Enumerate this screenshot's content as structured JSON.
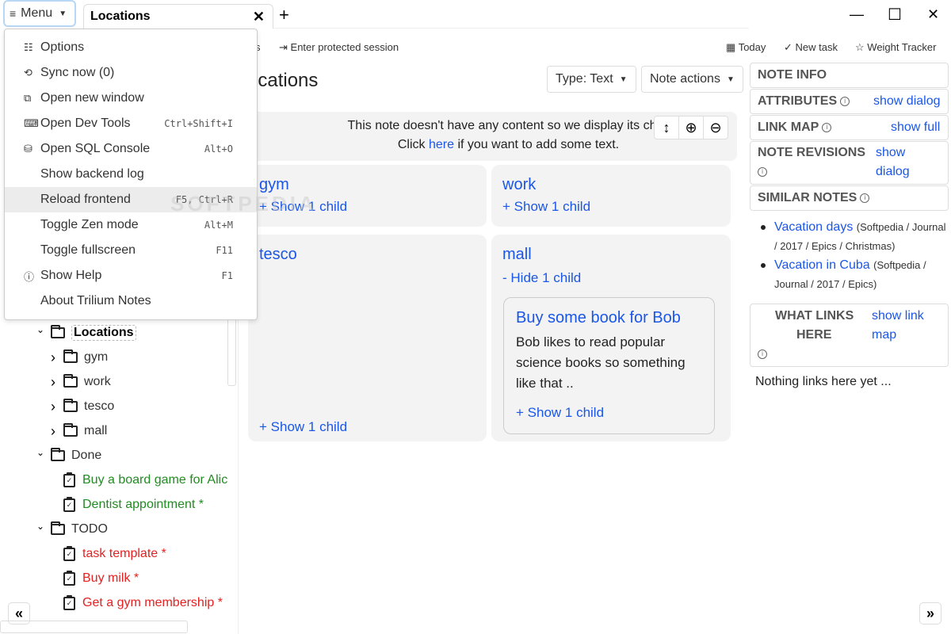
{
  "titlebar": {
    "menu_label": "Menu",
    "tab_title": "Locations",
    "tab_close": "✕",
    "new_tab": "+",
    "minimize": "—",
    "maximize": "☐",
    "close": "✕"
  },
  "toolbar": {
    "left_partial": "s",
    "protected_session": "Enter protected session",
    "today": "Today",
    "new_task": "New task",
    "weight_tracker": "Weight Tracker"
  },
  "menu": {
    "items": [
      {
        "icon": "options-icon",
        "glyph": "☷",
        "label": "Options",
        "shortcut": ""
      },
      {
        "icon": "sync-icon",
        "glyph": "⟲",
        "label": "Sync now (0)",
        "shortcut": ""
      },
      {
        "icon": "new-window-icon",
        "glyph": "⧉",
        "label": "Open new window",
        "shortcut": ""
      },
      {
        "icon": "terminal-icon",
        "glyph": "⌨",
        "label": "Open Dev Tools",
        "shortcut": "Ctrl+Shift+I"
      },
      {
        "icon": "database-icon",
        "glyph": "⛁",
        "label": "Open SQL Console",
        "shortcut": "Alt+O"
      },
      {
        "icon": "",
        "glyph": "",
        "label": "Show backend log",
        "shortcut": ""
      },
      {
        "icon": "",
        "glyph": "",
        "label": "Reload frontend",
        "shortcut": "F5, Ctrl+R"
      },
      {
        "icon": "",
        "glyph": "",
        "label": "Toggle Zen mode",
        "shortcut": "Alt+M"
      },
      {
        "icon": "",
        "glyph": "",
        "label": "Toggle fullscreen",
        "shortcut": "F11"
      },
      {
        "icon": "info-icon",
        "glyph": "ⓘ",
        "label": "Show Help",
        "shortcut": "F1"
      },
      {
        "icon": "",
        "glyph": "",
        "label": "About Trilium Notes",
        "shortcut": ""
      }
    ],
    "highlighted_index": 6
  },
  "tree": {
    "nodes": [
      {
        "label": "Locations",
        "type": "folder",
        "expanded": true,
        "level": 0,
        "active": true
      },
      {
        "label": "gym",
        "type": "folder",
        "expanded": false,
        "level": 1
      },
      {
        "label": "work",
        "type": "folder",
        "expanded": false,
        "level": 1
      },
      {
        "label": "tesco",
        "type": "folder",
        "expanded": false,
        "level": 1
      },
      {
        "label": "mall",
        "type": "folder",
        "expanded": false,
        "level": 1
      },
      {
        "label": "Done",
        "type": "folder",
        "expanded": true,
        "level": 0
      },
      {
        "label": "Buy a board game for Alic",
        "type": "task",
        "color": "green",
        "level": 1
      },
      {
        "label": "Dentist appointment *",
        "type": "task",
        "color": "green",
        "level": 1
      },
      {
        "label": "TODO",
        "type": "folder",
        "expanded": true,
        "level": 0
      },
      {
        "label": "task template *",
        "type": "task",
        "color": "red",
        "level": 1
      },
      {
        "label": "Buy milk *",
        "type": "task",
        "color": "red",
        "level": 1
      },
      {
        "label": "Get a gym membership *",
        "type": "task",
        "color": "red",
        "level": 1
      }
    ]
  },
  "note": {
    "title": "ocations",
    "type_button": "Type: Text",
    "actions_button": "Note actions",
    "info_line1": "This note doesn't have any content so we display its child",
    "info_click": "Click ",
    "info_here": "here",
    "info_rest": " if you want to add some text.",
    "cards": [
      {
        "title": "gym",
        "link": "+ Show 1 child"
      },
      {
        "title": "work",
        "link": "+ Show 1 child"
      },
      {
        "title": "tesco",
        "link": "+ Show 1 child"
      },
      {
        "title": "mall",
        "link": "- Hide 1 child"
      }
    ],
    "child_card": {
      "title": "Buy some book for Bob",
      "text": "Bob likes to read popular science books so something like that ..",
      "link": "+ Show 1 child"
    }
  },
  "right_panel": {
    "note_info": "NOTE INFO",
    "attributes": "ATTRIBUTES",
    "attributes_link": "show dialog",
    "link_map": "LINK MAP",
    "link_map_link": "show full",
    "note_revisions": "NOTE REVISIONS",
    "note_revisions_link1": "show",
    "note_revisions_link2": "dialog",
    "similar_notes": "SIMILAR NOTES",
    "similar": [
      {
        "title": "Vacation days",
        "path": "(Softpedia / Journal / 2017 / Epics / Christmas)"
      },
      {
        "title": "Vacation in Cuba",
        "path": "(Softpedia / Journal / 2017 / Epics)"
      }
    ],
    "what_links_1": "WHAT LINKS",
    "what_links_2": "HERE",
    "what_links_link1": "show link",
    "what_links_link2": "map",
    "nothing_links": "Nothing links here yet ..."
  },
  "watermark": "SOFTPEDIA"
}
